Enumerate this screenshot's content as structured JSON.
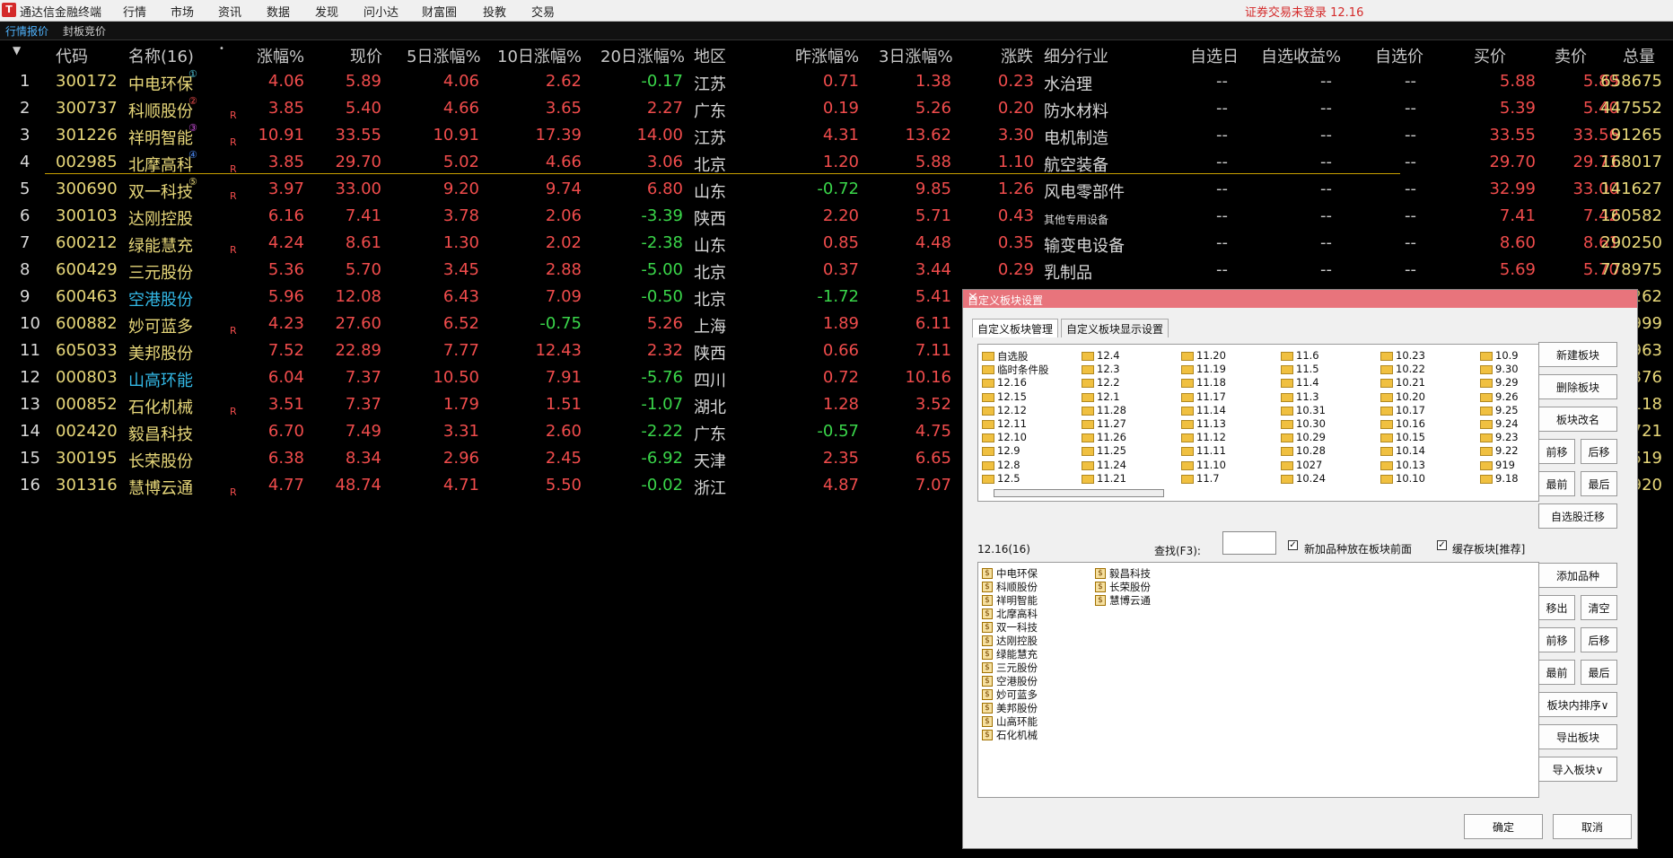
{
  "app": {
    "title": "通达信金融终端",
    "status": "证券交易未登录  12.16"
  },
  "menu": [
    "行情",
    "市场",
    "资讯",
    "数据",
    "发现",
    "问小达",
    "财富圈",
    "投教",
    "交易"
  ],
  "tabs": [
    "行情报价",
    "封板竞价"
  ],
  "columns": {
    "code": "代码",
    "name": "名称(16)",
    "chg": "涨幅%",
    "price": "现价",
    "d5": "5日涨幅%",
    "d10": "10日涨幅%",
    "d20": "20日涨幅%",
    "region": "地区",
    "prev": "昨涨幅%",
    "d3": "3日涨幅%",
    "diff": "涨跌",
    "industry": "细分行业",
    "zxday": "自选日",
    "zxgain": "自选收益%",
    "zxprice": "自选价",
    "bid": "买价",
    "ask": "卖价",
    "vol": "总量"
  },
  "rows": [
    {
      "i": "1",
      "code": "300172",
      "name": "中电环保",
      "badge": "①",
      "r": "",
      "chg": "4.06",
      "price": "5.89",
      "d5": "4.06",
      "d10": "2.62",
      "d20": "-0.17",
      "region": "江苏",
      "prev": "0.71",
      "d3": "1.38",
      "diff": "0.23",
      "industry": "水治理",
      "zxday": "--",
      "zxgain": "--",
      "zxprice": "--",
      "bid": "5.88",
      "ask": "5.89",
      "vol": "658675"
    },
    {
      "i": "2",
      "code": "300737",
      "name": "科顺股份",
      "badge": "②",
      "r": "R",
      "chg": "3.85",
      "price": "5.40",
      "d5": "4.66",
      "d10": "3.65",
      "d20": "2.27",
      "region": "广东",
      "prev": "0.19",
      "d3": "5.26",
      "diff": "0.20",
      "industry": "防水材料",
      "zxday": "--",
      "zxgain": "--",
      "zxprice": "--",
      "bid": "5.39",
      "ask": "5.40",
      "vol": "447552"
    },
    {
      "i": "3",
      "code": "301226",
      "name": "祥明智能",
      "badge": "③",
      "r": "R",
      "chg": "10.91",
      "price": "33.55",
      "d5": "10.91",
      "d10": "17.39",
      "d20": "14.00",
      "region": "江苏",
      "prev": "4.31",
      "d3": "13.62",
      "diff": "3.30",
      "industry": "电机制造",
      "zxday": "--",
      "zxgain": "--",
      "zxprice": "--",
      "bid": "33.55",
      "ask": "33.56",
      "vol": "91265"
    },
    {
      "i": "4",
      "code": "002985",
      "name": "北摩高科",
      "badge": "④",
      "r": "R",
      "chg": "3.85",
      "price": "29.70",
      "d5": "5.02",
      "d10": "4.66",
      "d20": "3.06",
      "region": "北京",
      "prev": "1.20",
      "d3": "5.88",
      "diff": "1.10",
      "industry": "航空装备",
      "zxday": "--",
      "zxgain": "--",
      "zxprice": "--",
      "bid": "29.70",
      "ask": "29.71",
      "vol": "168017"
    },
    {
      "i": "5",
      "code": "300690",
      "name": "双一科技",
      "badge": "⑤",
      "r": "R",
      "chg": "3.97",
      "price": "33.00",
      "d5": "9.20",
      "d10": "9.74",
      "d20": "6.80",
      "region": "山东",
      "prev": "-0.72",
      "d3": "9.85",
      "diff": "1.26",
      "industry": "风电零部件",
      "zxday": "--",
      "zxgain": "--",
      "zxprice": "--",
      "bid": "32.99",
      "ask": "33.00",
      "vol": "141627"
    },
    {
      "i": "6",
      "code": "300103",
      "name": "达刚控股",
      "badge": "",
      "r": "",
      "chg": "6.16",
      "price": "7.41",
      "d5": "3.78",
      "d10": "2.06",
      "d20": "-3.39",
      "region": "陕西",
      "prev": "2.20",
      "d3": "5.71",
      "diff": "0.43",
      "industry": "其他专用设备",
      "zxday": "--",
      "zxgain": "--",
      "zxprice": "--",
      "bid": "7.41",
      "ask": "7.42",
      "vol": "160582"
    },
    {
      "i": "7",
      "code": "600212",
      "name": "绿能慧充",
      "badge": "",
      "r": "R",
      "chg": "4.24",
      "price": "8.61",
      "d5": "1.30",
      "d10": "2.02",
      "d20": "-2.38",
      "region": "山东",
      "prev": "0.85",
      "d3": "4.48",
      "diff": "0.35",
      "industry": "输变电设备",
      "zxday": "--",
      "zxgain": "--",
      "zxprice": "--",
      "bid": "8.60",
      "ask": "8.61",
      "vol": "290250"
    },
    {
      "i": "8",
      "code": "600429",
      "name": "三元股份",
      "badge": "",
      "r": "",
      "chg": "5.36",
      "price": "5.70",
      "d5": "3.45",
      "d10": "2.88",
      "d20": "-5.00",
      "region": "北京",
      "prev": "0.37",
      "d3": "3.44",
      "diff": "0.29",
      "industry": "乳制品",
      "zxday": "--",
      "zxgain": "--",
      "zxprice": "--",
      "bid": "5.69",
      "ask": "5.70",
      "vol": "778975"
    },
    {
      "i": "9",
      "code": "600463",
      "name": "空港股份",
      "badge": "",
      "r": "",
      "chg": "5.96",
      "price": "12.08",
      "d5": "6.43",
      "d10": "7.09",
      "d20": "-0.50",
      "region": "北京",
      "prev": "-1.72",
      "d3": "5.41",
      "diff": "",
      "industry": "",
      "zxday": "",
      "zxgain": "",
      "zxprice": "",
      "bid": "",
      "ask": "",
      "vol": "262"
    },
    {
      "i": "10",
      "code": "600882",
      "name": "妙可蓝多",
      "badge": "",
      "r": "R",
      "chg": "4.23",
      "price": "27.60",
      "d5": "6.52",
      "d10": "-0.75",
      "d20": "5.26",
      "region": "上海",
      "prev": "1.89",
      "d3": "6.11",
      "diff": "",
      "industry": "",
      "zxday": "",
      "zxgain": "",
      "zxprice": "",
      "bid": "",
      "ask": "",
      "vol": "999"
    },
    {
      "i": "11",
      "code": "605033",
      "name": "美邦股份",
      "badge": "",
      "r": "",
      "chg": "7.52",
      "price": "22.89",
      "d5": "7.77",
      "d10": "12.43",
      "d20": "2.32",
      "region": "陕西",
      "prev": "0.66",
      "d3": "7.11",
      "diff": "",
      "industry": "",
      "zxday": "",
      "zxgain": "",
      "zxprice": "",
      "bid": "",
      "ask": "",
      "vol": "963"
    },
    {
      "i": "12",
      "code": "000803",
      "name": "山高环能",
      "badge": "",
      "r": "",
      "chg": "6.04",
      "price": "7.37",
      "d5": "10.50",
      "d10": "7.91",
      "d20": "-5.76",
      "region": "四川",
      "prev": "0.72",
      "d3": "10.16",
      "diff": "",
      "industry": "",
      "zxday": "",
      "zxgain": "",
      "zxprice": "",
      "bid": "",
      "ask": "",
      "vol": "376"
    },
    {
      "i": "13",
      "code": "000852",
      "name": "石化机械",
      "badge": "",
      "r": "R",
      "chg": "3.51",
      "price": "7.37",
      "d5": "1.79",
      "d10": "1.51",
      "d20": "-1.07",
      "region": "湖北",
      "prev": "1.28",
      "d3": "3.52",
      "diff": "",
      "industry": "",
      "zxday": "",
      "zxgain": "",
      "zxprice": "",
      "bid": "",
      "ask": "",
      "vol": "118"
    },
    {
      "i": "14",
      "code": "002420",
      "name": "毅昌科技",
      "badge": "",
      "r": "",
      "chg": "6.70",
      "price": "7.49",
      "d5": "3.31",
      "d10": "2.60",
      "d20": "-2.22",
      "region": "广东",
      "prev": "-0.57",
      "d3": "4.75",
      "diff": "",
      "industry": "",
      "zxday": "",
      "zxgain": "",
      "zxprice": "",
      "bid": "",
      "ask": "",
      "vol": "721"
    },
    {
      "i": "15",
      "code": "300195",
      "name": "长荣股份",
      "badge": "",
      "r": "",
      "chg": "6.38",
      "price": "8.34",
      "d5": "2.96",
      "d10": "2.45",
      "d20": "-6.92",
      "region": "天津",
      "prev": "2.35",
      "d3": "6.65",
      "diff": "",
      "industry": "",
      "zxday": "",
      "zxgain": "",
      "zxprice": "",
      "bid": "",
      "ask": "",
      "vol": "519"
    },
    {
      "i": "16",
      "code": "301316",
      "name": "慧博云通",
      "badge": "",
      "r": "R",
      "chg": "4.77",
      "price": "48.74",
      "d5": "4.71",
      "d10": "5.50",
      "d20": "-0.02",
      "region": "浙江",
      "prev": "4.87",
      "d3": "7.07",
      "diff": "",
      "industry": "",
      "zxday": "",
      "zxgain": "",
      "zxprice": "",
      "bid": "",
      "ask": "",
      "vol": "920"
    }
  ],
  "dialog": {
    "title": "自定义板块设置",
    "tabs": [
      "自定义板块管理",
      "自定义板块显示设置"
    ],
    "folders": [
      [
        "自选股",
        "临时条件股",
        "12.16",
        "12.15",
        "12.12",
        "12.11",
        "12.10",
        "12.9",
        "12.8",
        "12.5"
      ],
      [
        "12.4",
        "12.3",
        "12.2",
        "12.1",
        "11.28",
        "11.27",
        "11.26",
        "11.25",
        "11.24",
        "11.21"
      ],
      [
        "11.20",
        "11.19",
        "11.18",
        "11.17",
        "11.14",
        "11.13",
        "11.12",
        "11.11",
        "11.10",
        "11.7"
      ],
      [
        "11.6",
        "11.5",
        "11.4",
        "11.3",
        "10.31",
        "10.30",
        "10.29",
        "10.28",
        "1027",
        "10.24"
      ],
      [
        "10.23",
        "10.22",
        "10.21",
        "10.20",
        "10.17",
        "10.16",
        "10.15",
        "10.14",
        "10.13",
        "10.10"
      ],
      [
        "10.9",
        "9.30",
        "9.29",
        "9.26",
        "9.25",
        "9.24",
        "9.23",
        "9.22",
        "919",
        "9.18"
      ]
    ],
    "right_buttons": [
      "新建板块",
      "删除板块",
      "板块改名",
      "前移",
      "后移",
      "最前",
      "最后",
      "自选股迁移"
    ],
    "current_block": "12.16(16)",
    "search_label": "查找(F3):",
    "search_value": "",
    "check1": "新加品种放在板块前面",
    "check2": "缓存板块[推荐]",
    "stocks_col1": [
      "中电环保",
      "科顺股份",
      "祥明智能",
      "北摩高科",
      "双一科技",
      "达刚控股",
      "绿能慧充",
      "三元股份",
      "空港股份",
      "妙可蓝多",
      "美邦股份",
      "山高环能",
      "石化机械"
    ],
    "stocks_col2": [
      "毅昌科技",
      "长荣股份",
      "慧博云通"
    ],
    "bottom_buttons": [
      "添加品种",
      "移出",
      "清空",
      "前移",
      "后移",
      "最前",
      "最后",
      "板块内排序∨",
      "导出板块",
      "导入板块∨"
    ],
    "ok": "确定",
    "cancel": "取消"
  }
}
